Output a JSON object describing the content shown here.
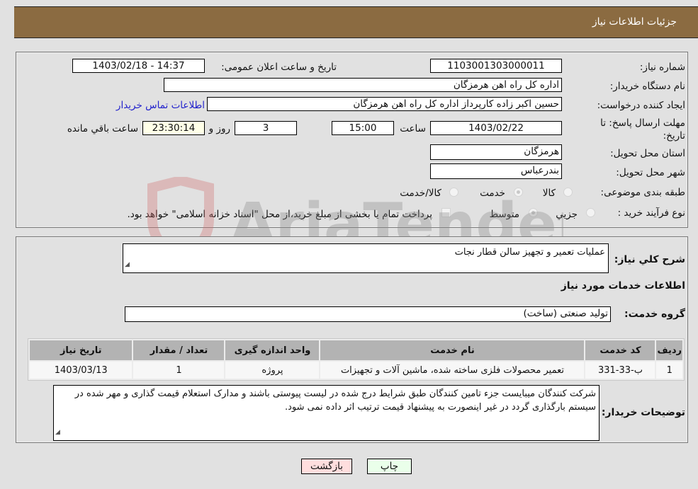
{
  "header": {
    "title": "جزئیات اطلاعات نیاز"
  },
  "form": {
    "need_number": {
      "label": "شماره نیاز:",
      "value": "1103001303000011"
    },
    "announce_datetime": {
      "label": "تاریخ و ساعت اعلان عمومی:",
      "value": "1403/02/18 - 14:37"
    },
    "buyer_org": {
      "label": "نام دستگاه خریدار:",
      "value": "اداره کل راه اهن هرمزگان"
    },
    "requester": {
      "label": "ایجاد کننده درخواست:",
      "value": "حسین اکبر زاده  کارپرداز اداره کل راه اهن هرمزگان"
    },
    "buyer_contact_link": "اطلاعات تماس خریدار",
    "deadline": {
      "label": "مهلت ارسال پاسخ: تا تاریخ:",
      "date": "1403/02/22",
      "time_label": "ساعت",
      "time": "15:00",
      "days": "3",
      "days_label": "روز و",
      "remaining": "23:30:14",
      "remaining_label": "ساعت باقي مانده"
    },
    "province": {
      "label": "استان محل تحویل:",
      "value": "هرمزگان"
    },
    "city": {
      "label": "شهر محل تحویل:",
      "value": "بندرعباس"
    },
    "category": {
      "label": "طبقه بندی موضوعی:",
      "options": [
        "کالا",
        "خدمت",
        "کالا/خدمت"
      ],
      "selected": "خدمت"
    },
    "purchase_type": {
      "label": "نوع فرآیند خرید :",
      "options": [
        "جزیي",
        "متوسط"
      ],
      "selected": "متوسط",
      "treasury_note": "پرداخت تمام یا بخشی از مبلغ خرید،از محل \"اسناد خزانه اسلامی\" خواهد بود.",
      "treasury_checked": false
    }
  },
  "details": {
    "description_label": "شرح کلي نیاز:",
    "description": "عملیات تعمیر و تجهیز سالن قطار نجات",
    "services_heading": "اطلاعات خدمات مورد نیاز",
    "service_group_label": "گروه خدمت:",
    "service_group": "تولید صنعتی (ساخت)",
    "table": {
      "headers": [
        "ردیف",
        "کد خدمت",
        "نام خدمت",
        "واحد اندازه گیری",
        "تعداد / مقدار",
        "تاریخ نیاز"
      ],
      "rows": [
        [
          "1",
          "ب-33-331",
          "تعمیر محصولات فلزی ساخته شده، ماشین آلات و تجهیزات",
          "پروژه",
          "1",
          "1403/03/13"
        ]
      ]
    },
    "buyer_notes_label": "توضیحات خریدار:",
    "buyer_notes": "شرکت کنندگان میبایست جزء تامین کنندگان طبق شرایط درج شده در لیست پیوستی باشند و مدارک استعلام قیمت گذاری و مهر شده در سیستم بارگذاری گردد در غیر اینصورت به پیشنهاد قیمت ترتیب اثر داده نمی شود."
  },
  "buttons": {
    "print": "چاپ",
    "back": "بازگشت"
  },
  "watermark": {
    "text": "AriaTender.neT"
  },
  "colors": {
    "header_bg": "#8b6b41",
    "print_bg": "#eaffea",
    "back_bg": "#ffdede",
    "link": "#2222cc"
  }
}
